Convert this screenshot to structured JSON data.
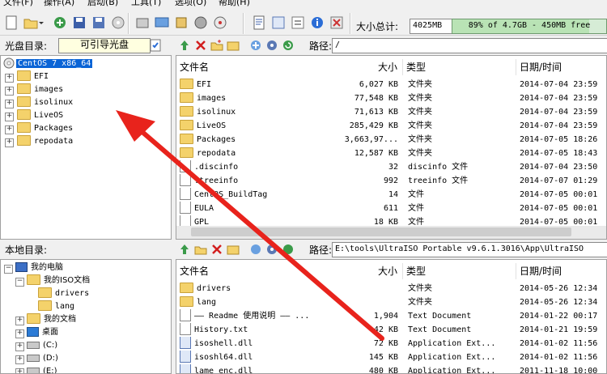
{
  "menu": [
    "文件(F)",
    "操作(A)",
    "启动(B)",
    "工具(T)",
    "选项(O)",
    "帮助(H)"
  ],
  "toolbar": {
    "total_size_label": "大小总计:",
    "total_size_value": "4025MB",
    "capacity_text": "89% of 4.7GB - 450MB free",
    "capacity_fraction": 0.89
  },
  "image_bar": {
    "label": "光盘目录:",
    "bootable_text": "可引导光盘",
    "path_label": "路径:",
    "path_value": "/"
  },
  "image_tree": {
    "root": "CentOS 7 x86_64",
    "children": [
      "EFI",
      "images",
      "isolinux",
      "LiveOS",
      "Packages",
      "repodata"
    ]
  },
  "columns": {
    "name": "文件名",
    "size": "大小",
    "type": "类型",
    "date": "日期/时间"
  },
  "image_files": [
    {
      "name": "EFI",
      "size": "6,027 KB",
      "type": "文件夹",
      "date": "2014-07-04 23:59",
      "kind": "folder"
    },
    {
      "name": "images",
      "size": "77,548 KB",
      "type": "文件夹",
      "date": "2014-07-04 23:59",
      "kind": "folder"
    },
    {
      "name": "isolinux",
      "size": "71,613 KB",
      "type": "文件夹",
      "date": "2014-07-04 23:59",
      "kind": "folder"
    },
    {
      "name": "LiveOS",
      "size": "285,429 KB",
      "type": "文件夹",
      "date": "2014-07-04 23:59",
      "kind": "folder"
    },
    {
      "name": "Packages",
      "size": "3,663,97...",
      "type": "文件夹",
      "date": "2014-07-05 18:26",
      "kind": "folder"
    },
    {
      "name": "repodata",
      "size": "12,587 KB",
      "type": "文件夹",
      "date": "2014-07-05 18:43",
      "kind": "folder"
    },
    {
      "name": ".discinfo",
      "size": "32",
      "type": "discinfo 文件",
      "date": "2014-07-04 23:50",
      "kind": "file"
    },
    {
      "name": ".treeinfo",
      "size": "992",
      "type": "treeinfo 文件",
      "date": "2014-07-07 01:29",
      "kind": "file"
    },
    {
      "name": "CentOS_BuildTag",
      "size": "14",
      "type": "文件",
      "date": "2014-07-05 00:01",
      "kind": "file"
    },
    {
      "name": "EULA",
      "size": "611",
      "type": "文件",
      "date": "2014-07-05 00:01",
      "kind": "file"
    },
    {
      "name": "GPL",
      "size": "18 KB",
      "type": "文件",
      "date": "2014-07-05 00:01",
      "kind": "file"
    }
  ],
  "local_bar": {
    "label": "本地目录:",
    "path_label": "路径:",
    "path_value": "E:\\tools\\UltraISO Portable v9.6.1.3016\\App\\UltraISO"
  },
  "local_tree": [
    {
      "label": "我的电脑",
      "indent": 0,
      "kind": "computer"
    },
    {
      "label": "我的ISO文档",
      "indent": 1,
      "kind": "folder"
    },
    {
      "label": "drivers",
      "indent": 2,
      "kind": "folder"
    },
    {
      "label": "lang",
      "indent": 2,
      "kind": "folder"
    },
    {
      "label": "我的文档",
      "indent": 1,
      "kind": "folder"
    },
    {
      "label": "桌面",
      "indent": 1,
      "kind": "desktop"
    },
    {
      "label": "(C:)",
      "indent": 1,
      "kind": "drive"
    },
    {
      "label": "(D:)",
      "indent": 1,
      "kind": "drive"
    },
    {
      "label": "(E:)",
      "indent": 1,
      "kind": "drive"
    }
  ],
  "local_files": [
    {
      "name": "drivers",
      "size": "",
      "type": "文件夹",
      "date": "2014-05-26 12:34",
      "kind": "folder"
    },
    {
      "name": "lang",
      "size": "",
      "type": "文件夹",
      "date": "2014-05-26 12:34",
      "kind": "folder"
    },
    {
      "name": "—— Readme 使用说明 —— ...",
      "size": "1,904",
      "type": "Text Document",
      "date": "2014-01-22 00:17",
      "kind": "file"
    },
    {
      "name": "History.txt",
      "size": "42 KB",
      "type": "Text Document",
      "date": "2014-01-21 19:59",
      "kind": "file"
    },
    {
      "name": "isoshell.dll",
      "size": "72 KB",
      "type": "Application Ext...",
      "date": "2014-01-02 11:56",
      "kind": "dll"
    },
    {
      "name": "isoshl64.dll",
      "size": "145 KB",
      "type": "Application Ext...",
      "date": "2014-01-02 11:56",
      "kind": "dll"
    },
    {
      "name": "lame_enc.dll",
      "size": "480 KB",
      "type": "Application Ext...",
      "date": "2011-11-18 10:00",
      "kind": "dll"
    }
  ],
  "colors": {
    "selection": "#0a64d6",
    "arrow": "#e8231c"
  }
}
